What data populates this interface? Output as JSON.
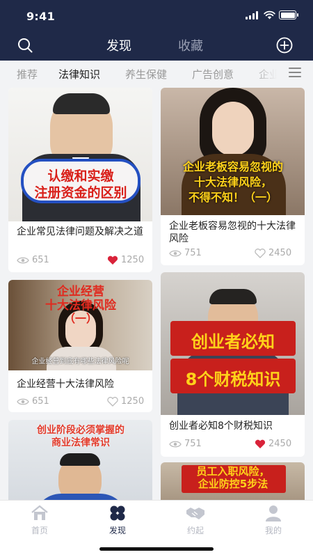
{
  "status": {
    "time": "9:41"
  },
  "header": {
    "tab_discover": "发现",
    "tab_favorites": "收藏"
  },
  "categories": [
    "推荐",
    "法律知识",
    "养生保健",
    "广告创意",
    "企业"
  ],
  "feed": [
    {
      "title": "企业常见法律问题及解决之道",
      "overlay": [
        "认缴和实缴",
        "注册资金的区别"
      ],
      "views": "651",
      "likes": "1250",
      "liked": true
    },
    {
      "title": "企业老板容易忽视的十大法律风险",
      "overlay": [
        "企业老板容易忽视的",
        "十大法律风险，",
        "不得不知！（一）"
      ],
      "views": "751",
      "likes": "2450",
      "liked": false
    },
    {
      "title": "企业经营十大法律风险",
      "overlay": [
        "企业经营",
        "十大法律风险",
        "（一）"
      ],
      "caption": "企业经营到底有哪些法律风险呢",
      "views": "651",
      "likes": "1250",
      "liked": false
    },
    {
      "title": "创业者必知8个财税知识",
      "overlay": [
        "创业者必知",
        "8个财税知识"
      ],
      "views": "751",
      "likes": "2450",
      "liked": true
    },
    {
      "title": "",
      "overlay": [
        "创业阶段必须掌握的",
        "商业法律常识"
      ],
      "views": "",
      "likes": "",
      "liked": false
    },
    {
      "title": "",
      "overlay": [
        "员工入职风险，",
        "企业防控5步法"
      ],
      "views": "",
      "likes": "",
      "liked": false
    }
  ],
  "nav": [
    {
      "label": "首页",
      "icon": "home-icon"
    },
    {
      "label": "发现",
      "icon": "discover-icon",
      "active": true
    },
    {
      "label": "约起",
      "icon": "handshake-icon"
    },
    {
      "label": "我的",
      "icon": "profile-icon"
    }
  ],
  "colors": {
    "header_bg": "#1f2948",
    "like_red": "#d9233a",
    "overlay_red": "#d9201a",
    "overlay_yellow": "#ffd21a"
  }
}
